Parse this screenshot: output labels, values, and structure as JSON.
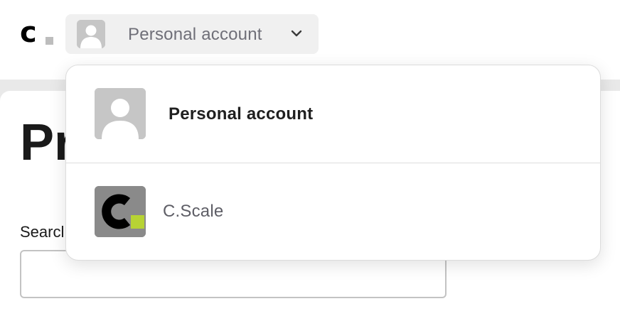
{
  "header": {
    "logo_text": "c",
    "account_switcher": {
      "selected_label": "Personal account",
      "avatar_icon": "user-silhouette-icon",
      "chevron_icon": "chevron-down-icon"
    }
  },
  "page": {
    "title": "Pr",
    "search_label": "Searcl",
    "search_value": "",
    "search_placeholder": ""
  },
  "dropdown": {
    "items": [
      {
        "label": "Personal account",
        "icon": "user-silhouette-icon",
        "selected": true
      },
      {
        "label": "C.Scale",
        "icon": "cscale-logo-icon",
        "selected": false
      }
    ]
  },
  "colors": {
    "brand_accent": "#b7d334",
    "avatar_gray": "#c6c6c6",
    "switcher_bg": "#f0f0f0"
  }
}
